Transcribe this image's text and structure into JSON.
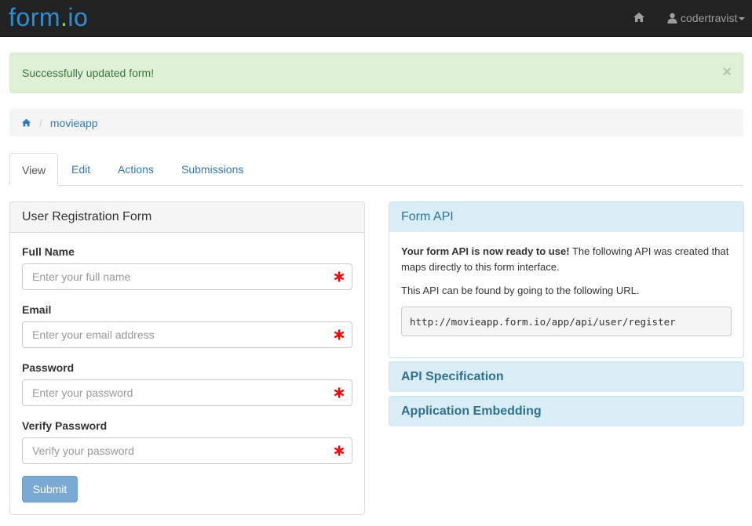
{
  "navbar": {
    "brand": {
      "part1": "form",
      "dot": ".",
      "part2": "io"
    },
    "home_icon": "home-icon",
    "user": {
      "icon": "user-icon",
      "name": "codertravist"
    }
  },
  "alert": {
    "message": "Successfully updated form!",
    "close": "×"
  },
  "breadcrumb": {
    "home_icon": "home-icon",
    "separator": "/",
    "items": [
      "movieapp"
    ]
  },
  "tabs": [
    {
      "label": "View",
      "active": true
    },
    {
      "label": "Edit"
    },
    {
      "label": "Actions"
    },
    {
      "label": "Submissions"
    }
  ],
  "form": {
    "title": "User Registration Form",
    "fields": [
      {
        "label": "Full Name",
        "placeholder": "Enter your full name",
        "required": true
      },
      {
        "label": "Email",
        "placeholder": "Enter your email address",
        "required": true
      },
      {
        "label": "Password",
        "placeholder": "Enter your password",
        "required": true
      },
      {
        "label": "Verify Password",
        "placeholder": "Verify your password",
        "required": true
      }
    ],
    "submit_label": "Submit"
  },
  "form_api": {
    "title": "Form API",
    "intro_bold": "Your form API is now ready to use!",
    "intro_rest": " The following API was created that maps directly to this form interface.",
    "url_note": "This API can be found by going to the following URL.",
    "url": "http://movieapp.form.io/app/api/user/register"
  },
  "api_spec": {
    "title": "API Specification"
  },
  "app_embed": {
    "title": "Application Embedding"
  },
  "colors": {
    "navbar_bg": "#222222",
    "link": "#337ab7",
    "success_bg": "#dff0d8",
    "success_text": "#3c763d",
    "info_bg": "#d9edf7",
    "info_text": "#31708f",
    "required": "#ff0000",
    "submit_bg": "#7aa9d4"
  }
}
